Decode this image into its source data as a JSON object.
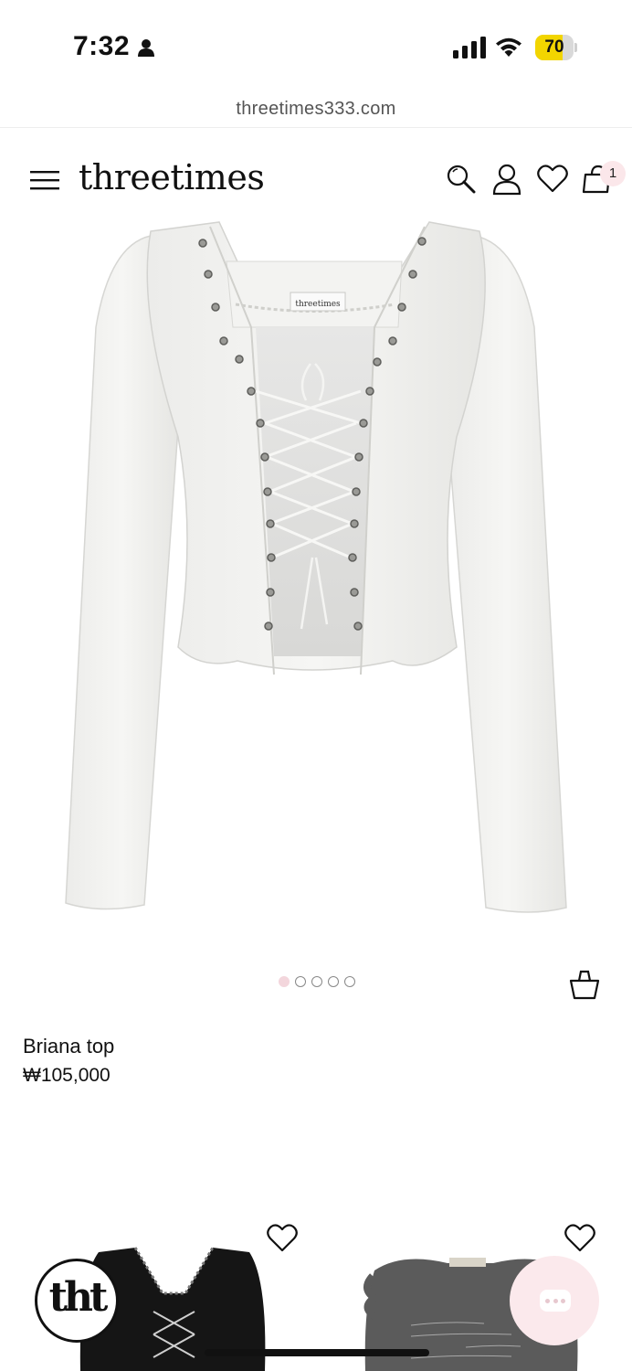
{
  "status_bar": {
    "time": "7:32",
    "battery": "70"
  },
  "browser": {
    "url": "threetimes333.com"
  },
  "header": {
    "logo": "threetimes",
    "cart_count": "1"
  },
  "product": {
    "name": "Briana top",
    "price": "₩105,000",
    "label_tag": "threetimes",
    "image_count": 5,
    "active_image": 1
  },
  "colors": {
    "accent_pink": "#f3d6dc",
    "text": "#111111",
    "battery_fill": "#f2d500"
  }
}
